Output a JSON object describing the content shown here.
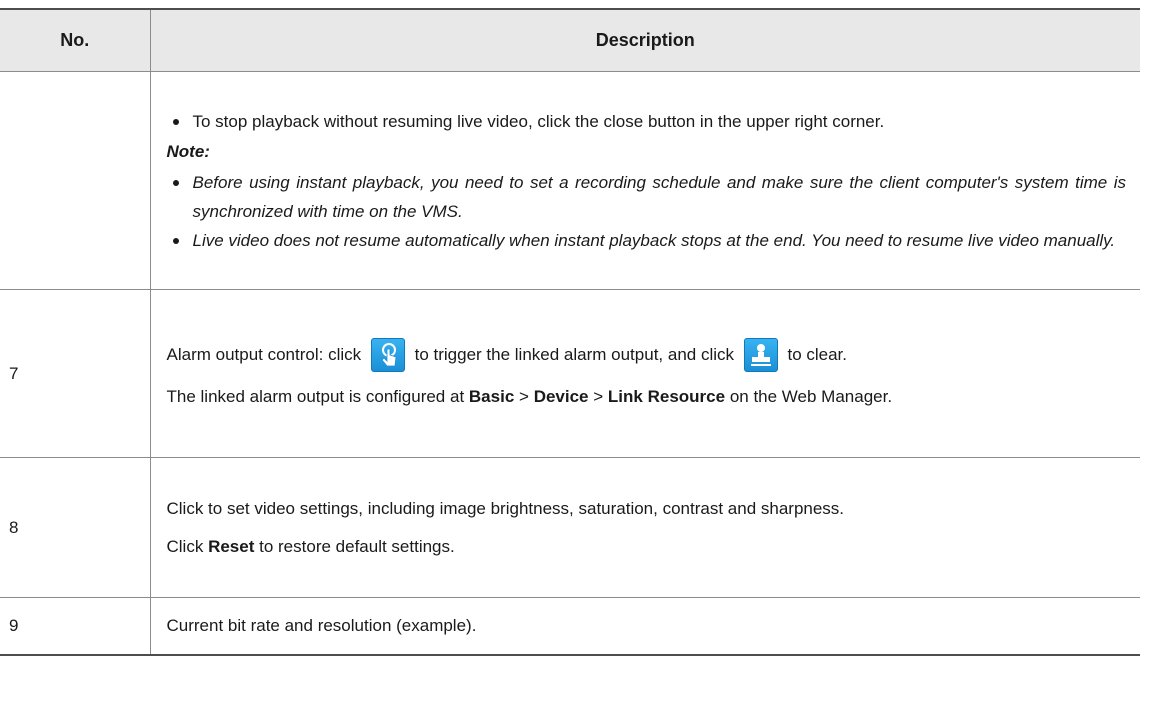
{
  "header": {
    "col_no": "No.",
    "col_desc": "Description"
  },
  "row_cont": {
    "bullet1": "To stop playback without resuming live video, click the close button in the upper right corner.",
    "note_label": "Note:",
    "note1": "Before using instant playback, you need to set a recording schedule and make sure the client computer's system time is synchronized with time on the VMS.",
    "note2": "Live video does not resume automatically when instant playback stops at the end. You need to resume live video manually."
  },
  "row7": {
    "no": "7",
    "text_a": "Alarm output control: click",
    "text_b": "to trigger the linked alarm output, and click",
    "text_c": "to clear.",
    "line2_a": "The linked alarm output is configured at",
    "basic": "Basic",
    "gt": ">",
    "device": "Device",
    "link_resource": "Link Resource",
    "line2_b": "on the Web Manager.",
    "icon_trigger": "trigger-alarm-icon",
    "icon_clear": "clear-alarm-icon"
  },
  "row8": {
    "no": "8",
    "line1": "Click to set video settings, including image brightness, saturation, contrast and sharpness.",
    "click": "Click",
    "reset": "Reset",
    "line2_b": "to restore default settings."
  },
  "row9": {
    "no": "9",
    "text": "Current bit rate and resolution (example)."
  }
}
